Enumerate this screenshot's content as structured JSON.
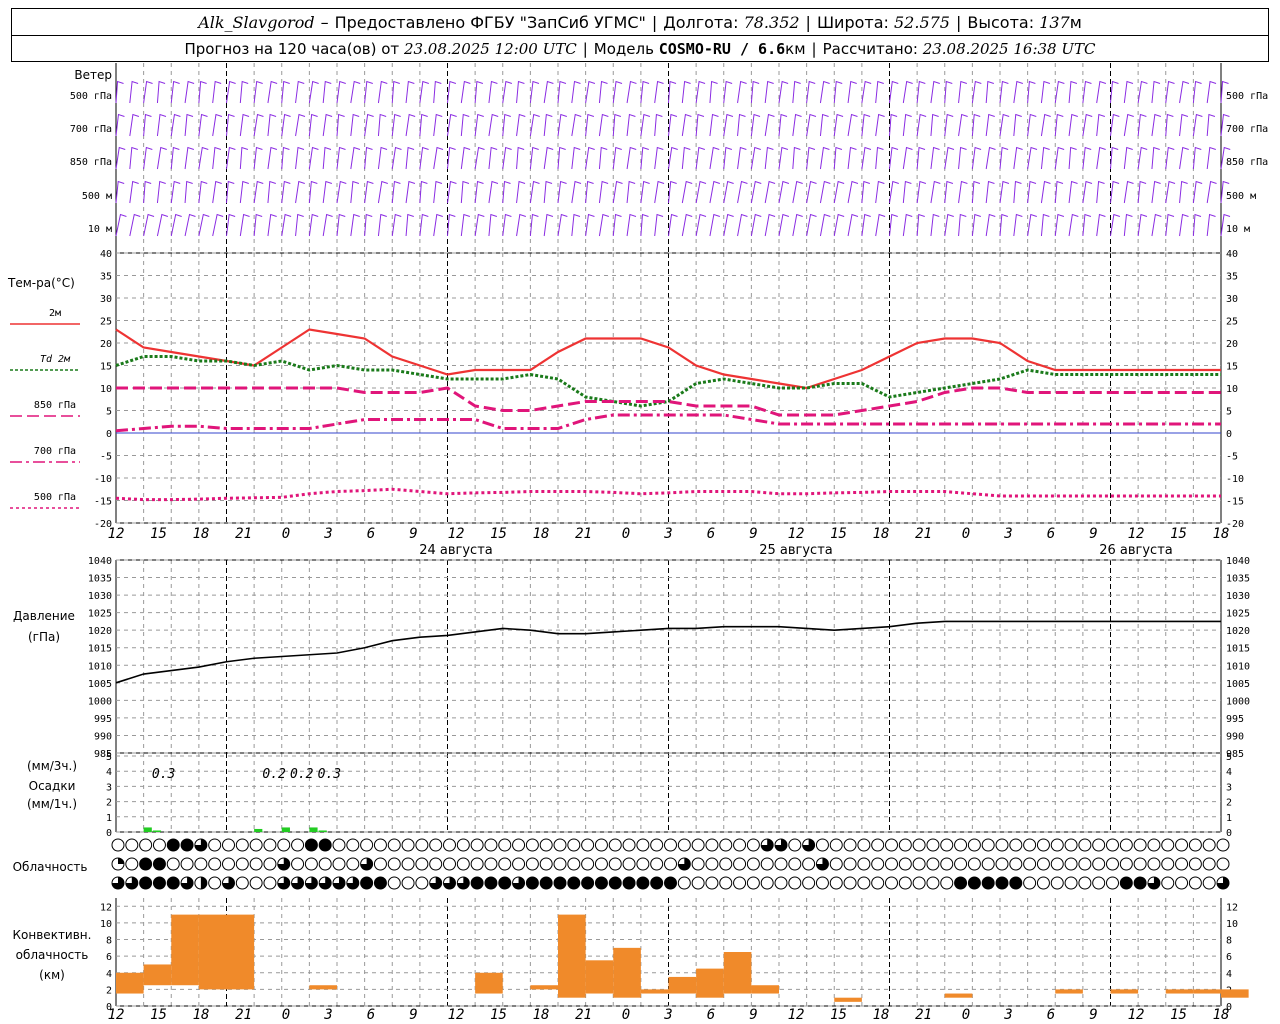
{
  "header": {
    "station": "Alk_Slavgorod",
    "dash": "–",
    "provider": "Предоставлено ФГБУ \"ЗапСиб УГМС\"",
    "lon_label": "Долгота:",
    "lon_value": "78.352",
    "lat_label": "Широта:",
    "lat_value": "52.575",
    "alt_label": "Высота:",
    "alt_value": "137",
    "alt_unit": "м",
    "forecast_label": "Прогноз на 120 часа(ов) от",
    "forecast_start": "23.08.2025 12:00 UTC",
    "model_label": "Модель",
    "model_name": "COSMO-RU / 6.6",
    "model_unit": "км",
    "calc_label": "Рассчитано:",
    "calc_time": "23.08.2025 16:38 UTC"
  },
  "time_axis": {
    "hour_labels": [
      "12",
      "15",
      "18",
      "21",
      "0",
      "3",
      "6",
      "9",
      "12",
      "15",
      "18",
      "21",
      "0",
      "3",
      "6",
      "9",
      "12",
      "15",
      "18",
      "21",
      "0",
      "3",
      "6",
      "9",
      "12",
      "15",
      "18"
    ],
    "day_labels": [
      {
        "text": "24 августа",
        "at_index": 8
      },
      {
        "text": "25 августа",
        "at_index": 16
      },
      {
        "text": "26 августа",
        "at_index": 24
      }
    ],
    "midnight_indices": [
      4,
      12,
      20
    ]
  },
  "wind_panel": {
    "title": "Ветер",
    "levels": [
      "500 гПа",
      "700 гПа",
      "850 гПа",
      "500 м",
      "10  м"
    ],
    "color": "#8a2be2"
  },
  "temp_panel": {
    "title": "Тем-ра(°С)",
    "legend": [
      {
        "label": "2м",
        "color": "#ee3333",
        "style": "solid"
      },
      {
        "label": "Td  2м",
        "color": "#1a7a1a",
        "style": "dotted"
      },
      {
        "label": "850 гПа",
        "color": "#e0157a",
        "style": "dash"
      },
      {
        "label": "700 гПа",
        "color": "#e0157a",
        "style": "dashdot"
      },
      {
        "label": "500 гПа",
        "color": "#e0157a",
        "style": "dot"
      }
    ],
    "ticks": [
      "40",
      "35",
      "30",
      "25",
      "20",
      "15",
      "10",
      "5",
      "0",
      "-5",
      "-10",
      "-15",
      "-20"
    ]
  },
  "pressure_panel": {
    "title1": "Давление",
    "title2": "(гПа)",
    "ticks": [
      "1040",
      "1035",
      "1030",
      "1025",
      "1020",
      "1015",
      "1010",
      "1005",
      "1000",
      "995",
      "990",
      "985"
    ]
  },
  "precip_panel": {
    "title1": "(мм/3ч.)",
    "title2": "Осадки",
    "title3": "(мм/1ч.)",
    "ticks": [
      "5",
      "4",
      "3",
      "2",
      "1",
      "0"
    ],
    "labels": [
      {
        "text": "0.3",
        "hour": 3
      },
      {
        "text": "0.2",
        "hour": 15
      },
      {
        "text": "0.2",
        "hour": 18
      },
      {
        "text": "0.3",
        "hour": 21
      }
    ],
    "color": "#22cc22"
  },
  "cloud_panel": {
    "title": "Облачность"
  },
  "conv_panel": {
    "title1": "Конвективн.",
    "title2": "облачность",
    "title3": "(км)",
    "ticks": [
      "12",
      "10",
      "8",
      "6",
      "4",
      "2",
      "0"
    ],
    "color": "#f08a2a"
  },
  "chart_data": [
    {
      "type": "line",
      "title": "Тем-ра(°С)",
      "x_hours_from_start": [
        0,
        3,
        6,
        9,
        12,
        15,
        18,
        21,
        24,
        27,
        30,
        33,
        36,
        39,
        42,
        45,
        48,
        51,
        54,
        57,
        60,
        63,
        66,
        69,
        72,
        75,
        78,
        81,
        84,
        87,
        90,
        93,
        96,
        99,
        102,
        105,
        108,
        111,
        114,
        117,
        120
      ],
      "ylim": [
        -20,
        40
      ],
      "series": [
        {
          "name": "2м",
          "values": [
            23,
            19,
            18,
            17,
            16,
            15,
            19,
            23,
            22,
            21,
            17,
            15,
            13,
            14,
            14,
            14,
            18,
            21,
            21,
            21,
            19,
            15,
            13,
            12,
            11,
            10,
            12,
            14,
            17,
            20,
            21,
            21,
            20,
            16,
            14,
            14,
            14,
            14,
            14,
            14,
            14
          ]
        },
        {
          "name": "Td  2м",
          "values": [
            15,
            17,
            17,
            16,
            16,
            15,
            16,
            14,
            15,
            14,
            14,
            13,
            12,
            12,
            12,
            13,
            12,
            8,
            7,
            6,
            7,
            11,
            12,
            11,
            10,
            10,
            11,
            11,
            8,
            9,
            10,
            11,
            12,
            14,
            13,
            13,
            13,
            13,
            13,
            13,
            13
          ]
        },
        {
          "name": "850 гПа",
          "values": [
            10,
            10,
            10,
            10,
            10,
            10,
            10,
            10,
            10,
            9,
            9,
            9,
            10,
            6,
            5,
            5,
            6,
            7,
            7,
            7,
            7,
            6,
            6,
            6,
            4,
            4,
            4,
            5,
            6,
            7,
            9,
            10,
            10,
            9,
            9,
            9,
            9,
            9,
            9,
            9,
            9
          ]
        },
        {
          "name": "700 гПа",
          "values": [
            0.5,
            1,
            1.5,
            1.5,
            1,
            1,
            1,
            1,
            2,
            3,
            3,
            3,
            3,
            3,
            1,
            1,
            1,
            3,
            4,
            4,
            4,
            4,
            4,
            3,
            2,
            2,
            2,
            2,
            2,
            2,
            2,
            2,
            2,
            2,
            2,
            2,
            2,
            2,
            2,
            2,
            2
          ]
        },
        {
          "name": "500 гПа",
          "values": [
            -14.5,
            -14.8,
            -14.8,
            -14.7,
            -14.5,
            -14.4,
            -14.3,
            -13.5,
            -13,
            -12.8,
            -12.5,
            -13,
            -13.5,
            -13.3,
            -13.2,
            -13,
            -13,
            -13,
            -13.2,
            -13.5,
            -13.3,
            -13,
            -13,
            -13,
            -13.5,
            -13.5,
            -13.3,
            -13.2,
            -13,
            -13,
            -13,
            -13.5,
            -14,
            -14,
            -14,
            -14,
            -14,
            -14,
            -14,
            -14,
            -14
          ]
        }
      ]
    },
    {
      "type": "line",
      "title": "Давление",
      "x_hours_from_start": [
        0,
        3,
        6,
        9,
        12,
        15,
        18,
        21,
        24,
        27,
        30,
        33,
        36,
        39,
        42,
        45,
        48,
        51,
        54,
        57,
        60,
        63,
        66,
        69,
        72,
        75,
        78,
        81,
        84,
        87,
        90,
        93,
        96,
        99,
        102,
        105,
        108,
        111,
        114,
        117,
        120
      ],
      "ylim": [
        985,
        1040
      ],
      "series": [
        {
          "name": "",
          "values": [
            1005,
            1007.5,
            1008.5,
            1009.5,
            1011,
            1012,
            1012.5,
            1013,
            1013.5,
            1015,
            1017,
            1018,
            1018.5,
            1019.5,
            1020.5,
            1020,
            1019,
            1019,
            1019.5,
            1020,
            1020.5,
            1020.5,
            1021,
            1021,
            1021,
            1020.5,
            1020,
            1020.5,
            1021,
            1022,
            1022.5,
            1022.5,
            1022.5,
            1022.5,
            1022.5,
            1022.5,
            1022.5,
            1022.5,
            1022.5,
            1022.5,
            1022.5
          ]
        }
      ]
    },
    {
      "type": "bar",
      "title": "Осадки",
      "ylim": [
        0,
        5
      ],
      "bars": [
        {
          "hour": 3,
          "value": 0.3
        },
        {
          "hour": 4,
          "value": 0.1
        },
        {
          "hour": 15,
          "value": 0.2
        },
        {
          "hour": 18,
          "value": 0.3
        },
        {
          "hour": 21,
          "value": 0.3
        },
        {
          "hour": 22,
          "value": 0.1
        }
      ]
    },
    {
      "type": "bar",
      "title": "Конвективн. облачность",
      "ylim": [
        0,
        13
      ],
      "bars": [
        {
          "hour": 0.5,
          "bottom": 1.5,
          "top": 4
        },
        {
          "hour": 1.5,
          "bottom": 2.5,
          "top": 5
        },
        {
          "hour": 2.5,
          "bottom": 2.5,
          "top": 11
        },
        {
          "hour": 3.5,
          "bottom": 2,
          "top": 11
        },
        {
          "hour": 4.5,
          "bottom": 2,
          "top": 11
        },
        {
          "hour": 7.5,
          "bottom": 2,
          "top": 2.5
        },
        {
          "hour": 13.5,
          "bottom": 1.5,
          "top": 4
        },
        {
          "hour": 15.5,
          "bottom": 2,
          "top": 2.5
        },
        {
          "hour": 16.5,
          "bottom": 1,
          "top": 11
        },
        {
          "hour": 17.5,
          "bottom": 1.5,
          "top": 5.5
        },
        {
          "hour": 18.5,
          "bottom": 1,
          "top": 7
        },
        {
          "hour": 19.5,
          "bottom": 1.5,
          "top": 2
        },
        {
          "hour": 20.5,
          "bottom": 1.5,
          "top": 3.5
        },
        {
          "hour": 21.5,
          "bottom": 1,
          "top": 4.5
        },
        {
          "hour": 22.5,
          "bottom": 1.5,
          "top": 6.5
        },
        {
          "hour": 23.5,
          "bottom": 1.5,
          "top": 2.5
        },
        {
          "hour": 26.5,
          "bottom": 0.5,
          "top": 1
        },
        {
          "hour": 30.5,
          "bottom": 1,
          "top": 1.5
        },
        {
          "hour": 34.5,
          "bottom": 1.5,
          "top": 2
        },
        {
          "hour": 36.5,
          "bottom": 1.5,
          "top": 2
        },
        {
          "hour": 38.5,
          "bottom": 1.5,
          "top": 2
        },
        {
          "hour": 39.5,
          "bottom": 1.5,
          "top": 2
        },
        {
          "hour": 40.5,
          "bottom": 1,
          "top": 2
        },
        {
          "hour": 60.5,
          "bottom": 1.5,
          "top": 2
        },
        {
          "hour": 63.5,
          "bottom": 1.5,
          "top": 2
        },
        {
          "hour": 70.5,
          "bottom": 1.5,
          "top": 2
        }
      ]
    }
  ],
  "cloud_rows": [
    "0000xx30000000xx0000000000000000000000000000000a30b0000000000000000000000000000000",
    "10xx00000000a00000300000000000000000000003000000000300000000000000000000000000000000",
    "33xxx3203000333333xx000333xxx3xxxxxxxxxxx00000000000000000000xxxxx0000000xx3000030000"
  ]
}
